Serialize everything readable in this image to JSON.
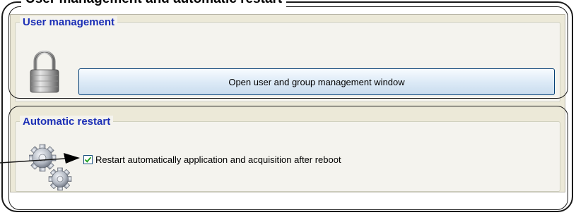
{
  "document": {
    "title": "User management and automatic restart"
  },
  "user_management": {
    "legend": "User management",
    "icon": "lock-icon",
    "button_label": "Open user and group management window"
  },
  "automatic_restart": {
    "legend": "Automatic restart",
    "icon": "gears-icon",
    "checkbox_label": "Restart automatically application and acquisition after reboot",
    "checked": true
  },
  "colors": {
    "legend_text": "#1c2fb6",
    "panel_background": "#ece9d8",
    "group_background": "#f4f3ee",
    "button_border": "#003c74",
    "check_mark": "#21a121"
  }
}
